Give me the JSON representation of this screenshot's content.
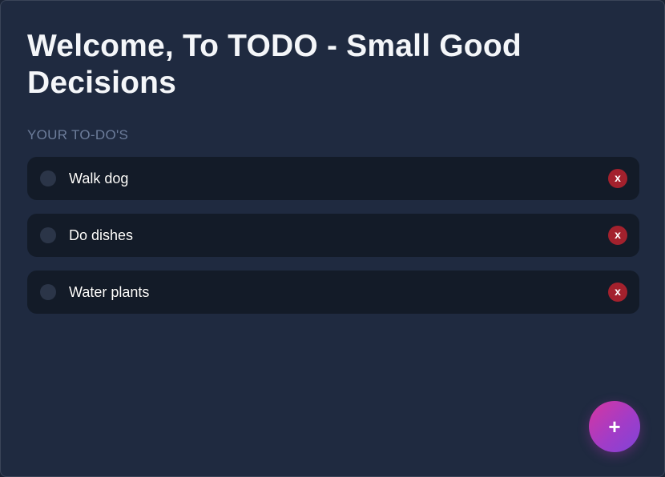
{
  "app": {
    "title": "Welcome, To TODO - Small Good Decisions",
    "section_label": "YOUR TO-DO'S"
  },
  "todos": [
    {
      "text": "Walk dog",
      "done": false,
      "delete_label": "x"
    },
    {
      "text": "Do dishes",
      "done": false,
      "delete_label": "x"
    },
    {
      "text": "Water plants",
      "done": false,
      "delete_label": "x"
    }
  ],
  "fab": {
    "label": "+",
    "icon": "plus-icon"
  },
  "colors": {
    "background": "#1f2a40",
    "card": "#131b28",
    "delete_button": "#a3212d",
    "fab_gradient_start": "#d636a0",
    "fab_gradient_end": "#7f44d8",
    "section_label": "#6d7d9b"
  }
}
